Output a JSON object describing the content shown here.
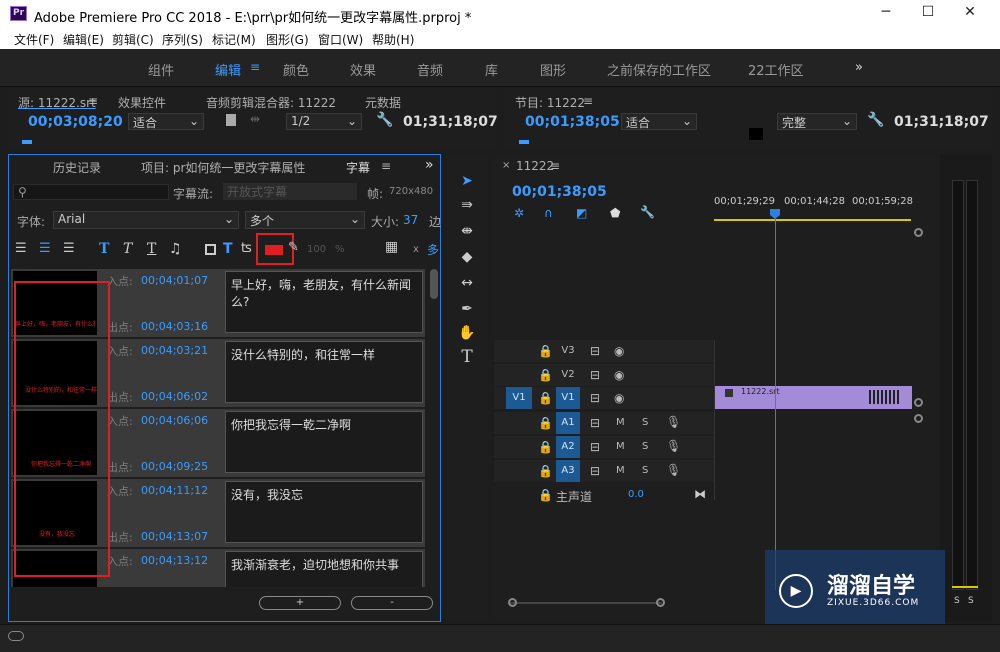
{
  "window": {
    "title": "Adobe Premiere Pro CC 2018 - E:\\prr\\pr如何统一更改字幕属性.prproj *",
    "app_icon": "Pr",
    "min": "─",
    "max": "☐",
    "close": "✕"
  },
  "menu": [
    "文件(F)",
    "编辑(E)",
    "剪辑(C)",
    "序列(S)",
    "标记(M)",
    "图形(G)",
    "窗口(W)",
    "帮助(H)"
  ],
  "workspaces": [
    "组件",
    "编辑",
    "颜色",
    "效果",
    "音频",
    "库",
    "图形",
    "之前保存的工作区",
    "22工作区"
  ],
  "workspace_more": "»",
  "source": {
    "tab": "源: 11222.srt",
    "tabs": [
      "效果控件",
      "音频剪辑混合器: 11222",
      "元数据"
    ],
    "timecode": "00;03;08;20",
    "fit": "适合",
    "res": "1/2",
    "duration": "01;31;18;07"
  },
  "program": {
    "tab": "节目: 11222",
    "timecode": "00;01;38;05",
    "fit": "适合",
    "quality": "完整",
    "duration": "01;31;18;07"
  },
  "left_panel": {
    "tabs": [
      "历史记录",
      "项目: pr如何统一更改字幕属性",
      "字幕"
    ],
    "stream_label": "字幕流:",
    "stream_value": "开放式字幕",
    "frame_label": "帧:",
    "frame_value": "720x480",
    "font_label": "字体:",
    "font_value": "Arial",
    "style_value": "多个",
    "size_label": "大小:",
    "size_value": "37",
    "edge_label": "边",
    "opacity": "100",
    "pct": "%",
    "x": "x",
    "more": "多",
    "add": "+",
    "remove": "-"
  },
  "captions": [
    {
      "in": "00;04;01;07",
      "out": "00;04;03;16",
      "text": "早上好，嗨，老朋友，有什么新闻么?",
      "thumb": "早上好，嗨，老朋友，有什么新"
    },
    {
      "in": "00;04;03;21",
      "out": "00;04;06;02",
      "text": "没什么特别的，和往常一样",
      "thumb": "没什么特别的，和往常一样"
    },
    {
      "in": "00;04;06;06",
      "out": "00;04;09;25",
      "text": "你把我忘得一乾二净啊",
      "thumb": "你把我忘得一乾二净啊"
    },
    {
      "in": "00;04;11;12",
      "out": "00;04;13;07",
      "text": "没有，我没忘",
      "thumb": "没有，我没忘"
    },
    {
      "in": "00;04;13;12",
      "out": "",
      "text": "我渐渐衰老，迫切地想和你共事",
      "thumb": ""
    }
  ],
  "caption_labels": {
    "in": "入点:",
    "out": "出点:"
  },
  "timeline": {
    "tab": "11222",
    "timecode": "00;01;38;05",
    "ruler": [
      "00;01;29;29",
      "00;01;44;28",
      "00;01;59;28"
    ],
    "video_tracks": [
      "V3",
      "V2",
      "V1"
    ],
    "audio_tracks": [
      "A1",
      "A2",
      "A3"
    ],
    "src_v": "V1",
    "master": "主声道",
    "master_val": "0.0",
    "clip": "11222.srt",
    "m": "M",
    "s": "S"
  },
  "meters": {
    "s1": "S",
    "s2": "S"
  },
  "watermark": {
    "title": "溜溜自学",
    "url": "ZIXUE.3D66.COM"
  },
  "colors": {
    "accent": "#3a9cff",
    "clip": "#a38bd8",
    "highlight": "#e02020",
    "playhead": "#2f7fe0"
  }
}
